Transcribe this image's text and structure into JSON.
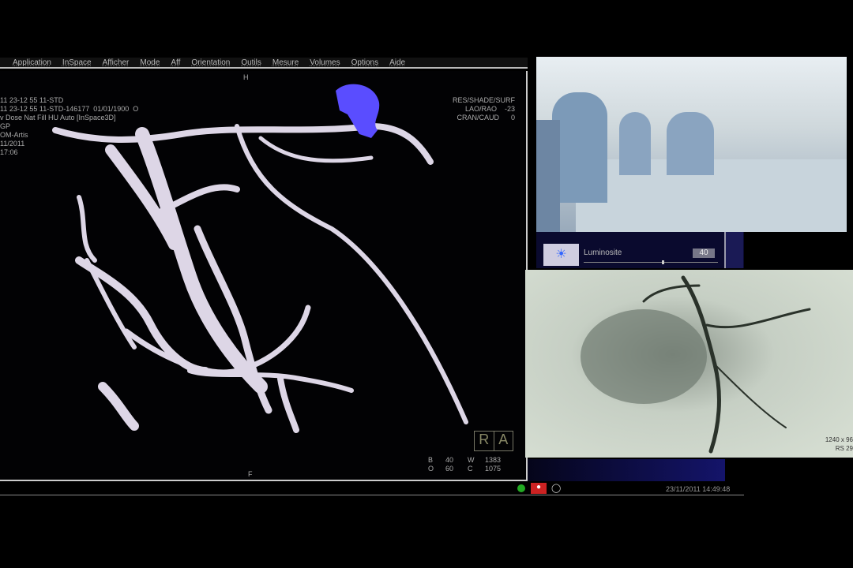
{
  "menu": [
    "Application",
    "InSpace",
    "Afficher",
    "Mode",
    "Aff",
    "Orientation",
    "Outils",
    "Mesure",
    "Volumes",
    "Options",
    "Aide"
  ],
  "viewer": {
    "top_marker": "H",
    "bottom_marker": "F",
    "info_left": [
      "11 23-12 55 11-STD",
      "11 23-12 55 11-STD-146177  01/01/1900  O",
      "v Dose Nat Fill HU Auto [InSpace3D]",
      "GP",
      "OM-Artis",
      "11/2011",
      "17:06"
    ],
    "info_right": [
      "RES/SHADE/SURF",
      "LAO/RAO    -23",
      "CRAN/CAUD      0"
    ],
    "orientation_box": [
      "R",
      "A"
    ],
    "window": {
      "b_label": "B",
      "b": "40",
      "w_label": "W",
      "w": "1383",
      "o_label": "O",
      "o": "60",
      "c_label": "C",
      "c": "1075"
    }
  },
  "luminosity": {
    "label": "Luminosite",
    "value": "40",
    "level": 0.58
  },
  "angio": {
    "info": [
      "1240 x 96",
      "RS 29"
    ]
  },
  "status": {
    "datetime": "23/11/2011 14:49:48"
  },
  "colors": {
    "vessel": "#e0d8e8",
    "marker": "#5a4dff"
  }
}
